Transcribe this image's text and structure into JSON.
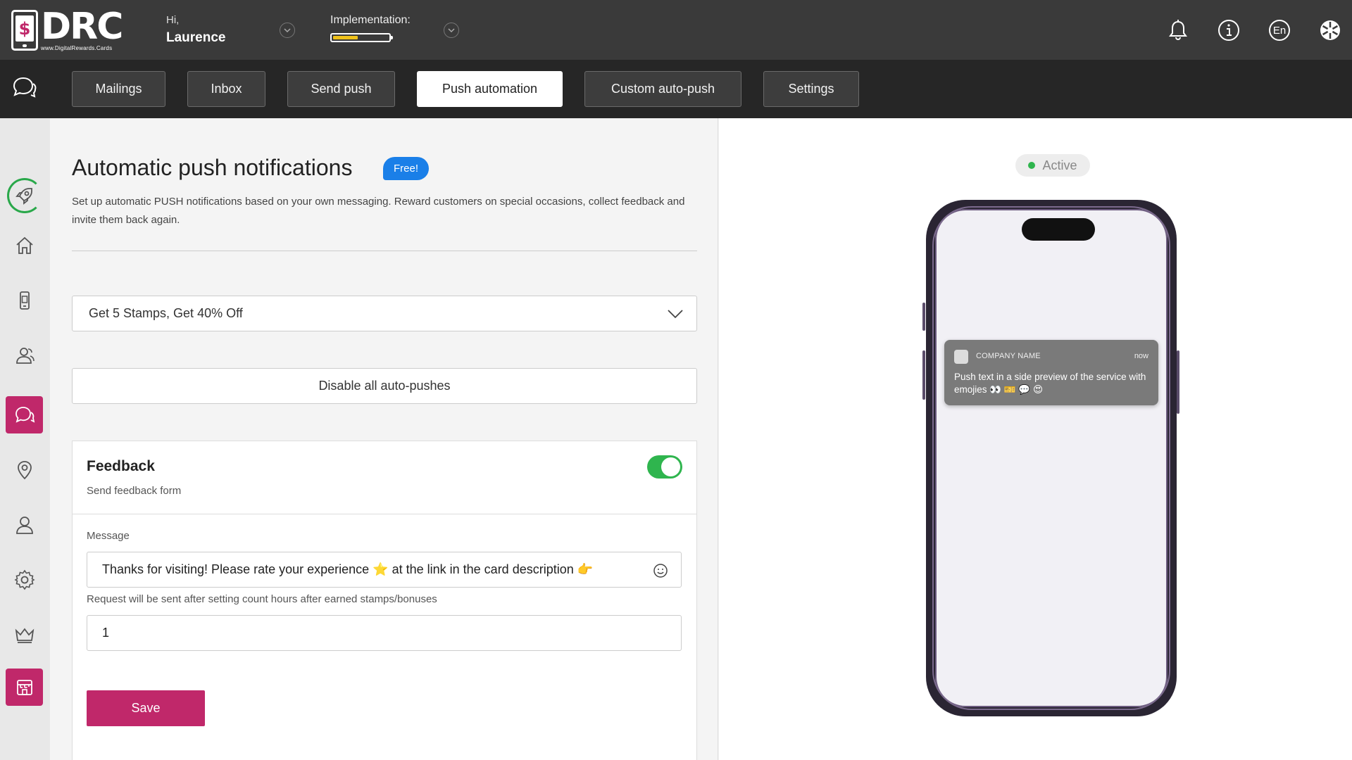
{
  "header": {
    "logo_text": "DRC",
    "logo_url_text": "www.DigitalRewards.Cards",
    "greeting": "Hi,",
    "user_name": "Laurence",
    "implementation_label": "Implementation:",
    "implementation_progress": 0.45
  },
  "nav": {
    "tabs": [
      {
        "label": "Mailings"
      },
      {
        "label": "Inbox"
      },
      {
        "label": "Send push"
      },
      {
        "label": "Push automation",
        "active": true
      },
      {
        "label": "Custom auto-push"
      },
      {
        "label": "Settings"
      }
    ],
    "language": "En"
  },
  "sidebar": {
    "items": [
      "rocket-icon",
      "home-icon",
      "phone-card-icon",
      "customers-icon",
      "chat-icon",
      "location-icon",
      "user-icon",
      "gear-icon",
      "crown-icon",
      "store-icon"
    ],
    "active": "chat-icon"
  },
  "main": {
    "title": "Automatic push notifications",
    "badge": "Free!",
    "description": "Set up automatic PUSH notifications based on your own messaging. Reward customers on special occasions, collect feedback and invite them back again.",
    "selected_campaign": "Get 5 Stamps, Get 40% Off",
    "disable_label": "Disable all auto-pushes",
    "card": {
      "title": "Feedback",
      "subtitle": "Send feedback form",
      "enabled": true,
      "message_label": "Message",
      "message_value": "Thanks for visiting! Please rate your experience ⭐ at the link in the card description 👉",
      "hours_label": "Request will be sent after setting count hours after earned stamps/bonuses",
      "hours_value": "1",
      "save_label": "Save"
    }
  },
  "preview": {
    "status": "Active",
    "status_color": "#2fb54e",
    "notification": {
      "app_name": "COMPANY NAME",
      "time": "now",
      "text": "Push text in a side preview of the service with emojies 👀 🎫 💬 😍"
    }
  },
  "colors": {
    "brand": "#c0286a",
    "badge": "#1a7fe8",
    "toggle_on": "#2fb54e",
    "progress": "#f0c21a"
  }
}
